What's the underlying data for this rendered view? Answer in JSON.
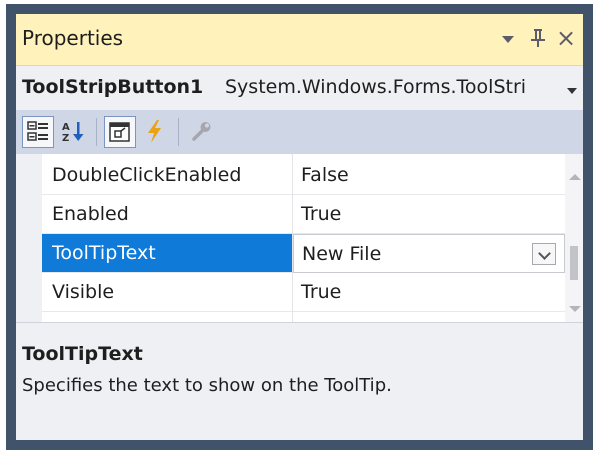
{
  "window": {
    "title": "Properties",
    "controls": {
      "dropdown": "window-position-menu",
      "pin": "auto-hide-pin",
      "close": "close"
    }
  },
  "object_selector": {
    "name": "ToolStripButton1",
    "type": "System.Windows.Forms.ToolStri"
  },
  "toolbar": {
    "buttons": [
      "categorized",
      "alphabetical",
      "properties",
      "events",
      "property-pages"
    ],
    "active": "properties"
  },
  "grid": {
    "rows": [
      {
        "name": "DoubleClickEnabled",
        "value": "False",
        "selected": false
      },
      {
        "name": "Enabled",
        "value": "True",
        "selected": false
      },
      {
        "name": "ToolTipText",
        "value": "New File",
        "selected": true
      },
      {
        "name": "Visible",
        "value": "True",
        "selected": false
      }
    ]
  },
  "description": {
    "title": "ToolTipText",
    "text": "Specifies the text to show on the ToolTip."
  },
  "colors": {
    "border": "#41536b",
    "titlebar": "#fff2bb",
    "toolbar": "#cfd6e5",
    "selection": "#0f7ad8",
    "events_icon": "#e8a317"
  }
}
